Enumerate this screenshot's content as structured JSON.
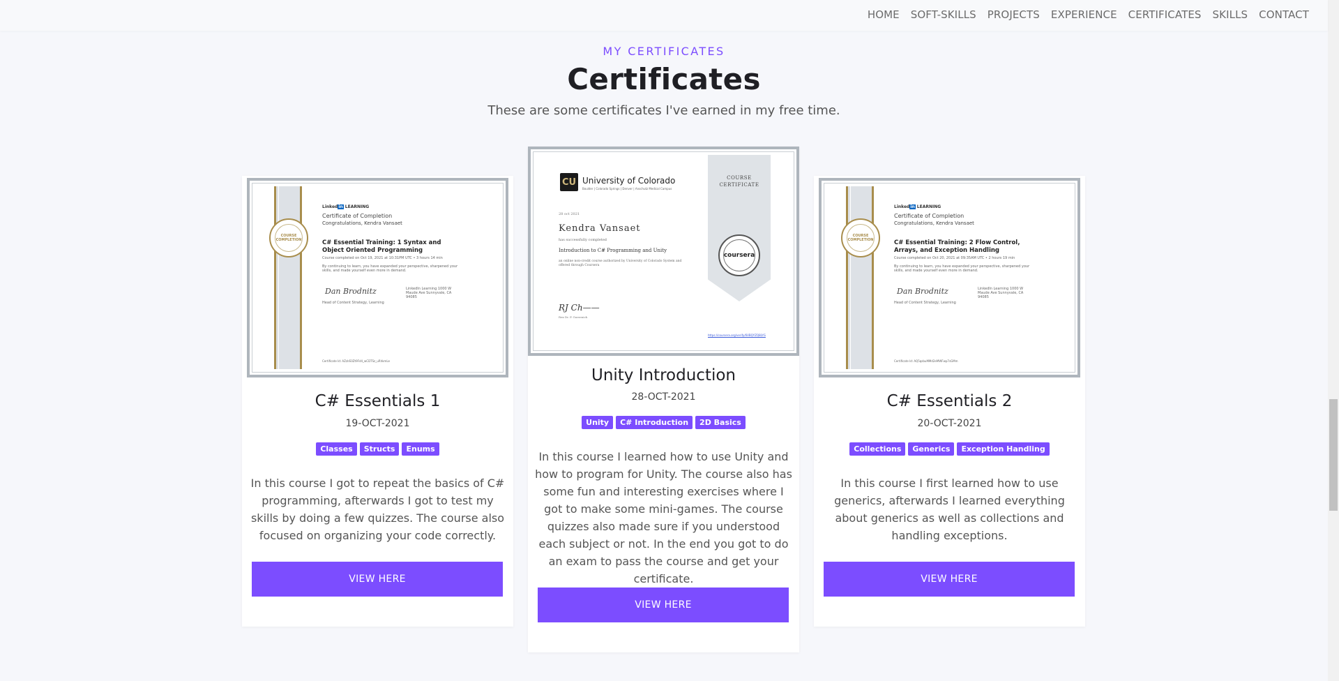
{
  "nav": {
    "items": [
      "HOME",
      "SOFT-SKILLS",
      "PROJECTS",
      "EXPERIENCE",
      "CERTIFICATES",
      "SKILLS",
      "CONTACT"
    ]
  },
  "section": {
    "eyebrow": "MY CERTIFICATES",
    "title": "Certificates",
    "subtitle": "These are some certificates I've earned in my free time."
  },
  "cards": [
    {
      "title": "C# Essentials 1",
      "date": "19-OCT-2021",
      "tags": [
        "Classes",
        "Structs",
        "Enums"
      ],
      "description": "In this course I got to repeat the basics of C# programming, afterwards I got to test my skills by doing a few quizzes. The course also focused on organizing your code correctly.",
      "button": "VIEW HERE",
      "certificate": {
        "provider_prefix": "Linked",
        "provider_in": "in",
        "provider_suffix": "LEARNING",
        "heading": "Certificate of Completion",
        "congrats": "Congratulations, Kendra Vansaet",
        "course_line1": "C# Essential Training: 1 Syntax and",
        "course_line2": "Object Oriented Programming",
        "completed": "Course completed on Oct 19, 2021 at 10:31PM UTC  •  3 hours 14 min",
        "body": "By continuing to learn, you have expanded your perspective, sharpened your skills, and made yourself even more in demand.",
        "signer_title": "Head of Content Strategy, Learning",
        "address": "LinkedIn Learning  1000 W Maude Ave  Sunnyvale, CA 94085",
        "medal": "COURSE COMPLETION",
        "cert_id": "Certificate Id: AZzlrE0Zt9Fd4_wCDTSz_uRhkmLe"
      }
    },
    {
      "title": "Unity Introduction",
      "date": "28-OCT-2021",
      "tags": [
        "Unity",
        "C# Introduction",
        "2D Basics"
      ],
      "description": "In this course I learned how to use Unity and how to program for Unity. The course also has some fun and interesting exercises where I got to make some mini-games. The course quizzes also made sure if you understood each subject or not. In the end you got to do an exam to pass the course and get your certificate.",
      "button": "VIEW HERE",
      "certificate": {
        "logo_mark": "CU",
        "university": "University of Colorado",
        "university_sub": "Boulder | Colorado Springs | Denver | Anschutz Medical Campus",
        "date": "28 oct 2021",
        "name": "Kendra Vansaet",
        "completed_text": "has successfully completed",
        "course": "Introduction to C# Programming and Unity",
        "offered": "an online non-credit course authorized by University of Colorado System and offered through Coursera",
        "banner": "COURSE CERTIFICATE",
        "seal": "coursera",
        "signer": "Rex Dr. P. Gurzenich",
        "verify_link": "https://coursera.org/verify/6VBQYZQ8LYG"
      }
    },
    {
      "title": "C# Essentials 2",
      "date": "20-OCT-2021",
      "tags": [
        "Collections",
        "Generics",
        "Exception Handling"
      ],
      "description": "In this course I first learned how to use generics, afterwards I learned everything about generics as well as collections and handling exceptions.",
      "button": "VIEW HERE",
      "certificate": {
        "provider_prefix": "Linked",
        "provider_in": "in",
        "provider_suffix": "LEARNING",
        "heading": "Certificate of Completion",
        "congrats": "Congratulations, Kendra Vansaet",
        "course_line1": "C# Essential Training: 2 Flow Control,",
        "course_line2": "Arrays, and Exception Handling",
        "completed": "Course completed on Oct 20, 2021 at 09:35AM UTC  •  2 hours 19 min",
        "body": "By continuing to learn, you have expanded your perspective, sharpened your skills, and made yourself even more in demand.",
        "signer_title": "Head of Content Strategy, Learning",
        "address": "LinkedIn Learning  1000 W Maude Ave  Sunnyvale, CA 94085",
        "medal": "COURSE COMPLETION",
        "cert_id": "Certificate Id: AQ5qsbuMMd2eMWFwp7sGMm"
      }
    }
  ],
  "colors": {
    "accent": "#7c4dff",
    "background": "#f6f7fb",
    "card": "#ffffff",
    "gold": "#a88d4c"
  }
}
